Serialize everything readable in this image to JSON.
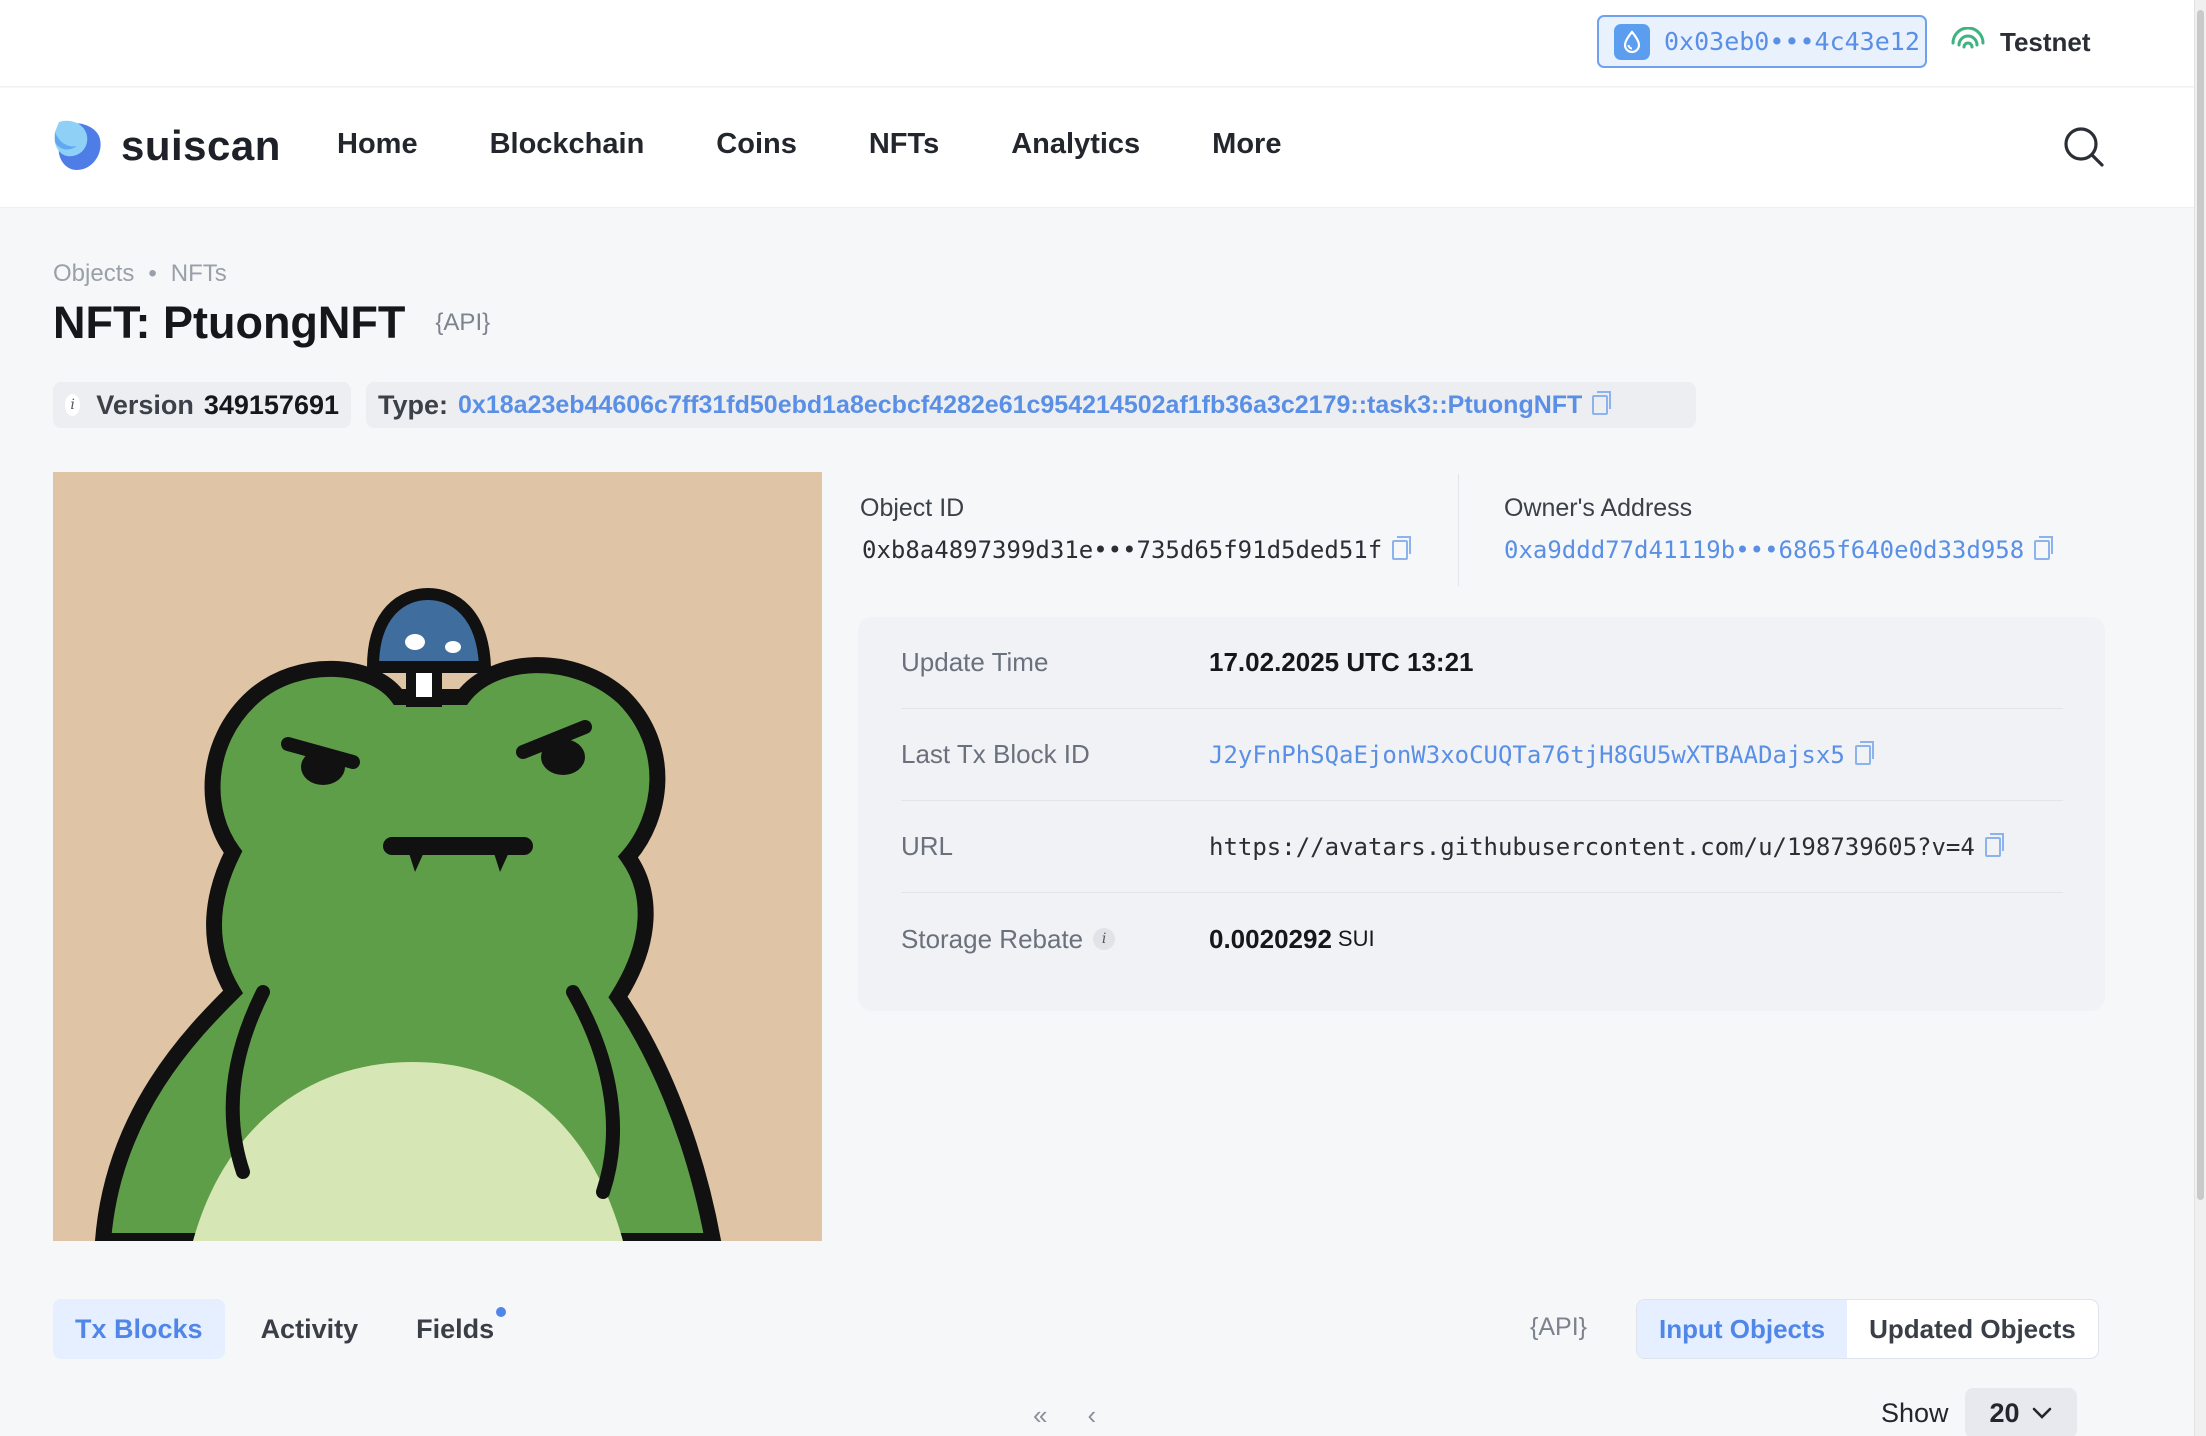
{
  "header": {
    "wallet_address": "0x03eb0•••4c43e12",
    "network": "Testnet"
  },
  "nav": {
    "brand": "suiscan",
    "items": [
      "Home",
      "Blockchain",
      "Coins",
      "NFTs",
      "Analytics",
      "More"
    ]
  },
  "breadcrumb": [
    "Objects",
    "NFTs"
  ],
  "page": {
    "title": "NFT: PtuongNFT",
    "api_label": "{API}"
  },
  "meta": {
    "version_label": "Version",
    "version_value": "349157691",
    "type_label": "Type:",
    "type_value": "0x18a23eb44606c7ff31fd50ebd1a8ecbcf4282e61c954214502af1fb36a3c2179::task3::PtuongNFT"
  },
  "object": {
    "object_id_label": "Object ID",
    "object_id_value": "0xb8a4897399d31e•••735d65f91d5ded51f",
    "owner_label": "Owner's Address",
    "owner_value": "0xa9ddd77d41119b•••6865f640e0d33d958"
  },
  "details": [
    {
      "key": "Update Time",
      "value": "17.02.2025 UTC 13:21"
    },
    {
      "key": "Last Tx Block ID",
      "value": "J2yFnPhSQaEjonW3xoCUQTa76tjH8GU5wXTBAADajsx5"
    },
    {
      "key": "URL",
      "value": "https://avatars.githubusercontent.com/u/198739605?v=4"
    },
    {
      "key": "Storage Rebate",
      "value": "0.0020292",
      "unit": "SUI"
    }
  ],
  "tabs": [
    "Tx Blocks",
    "Activity",
    "Fields"
  ],
  "segmented": [
    "Input Objects",
    "Updated Objects"
  ],
  "pagination": {
    "first": "«",
    "prev": "‹",
    "show_label": "Show",
    "page_size": "20"
  },
  "colors": {
    "accent": "#4f86e8",
    "link": "#5a8fe6",
    "nft_bg": "#dfc4a6",
    "frog_green": "#5f9e48"
  }
}
